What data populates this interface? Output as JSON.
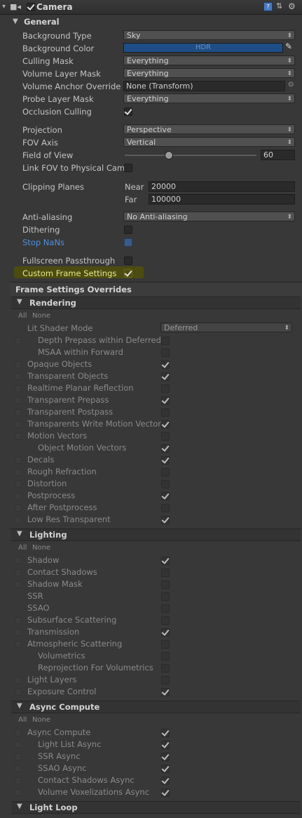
{
  "component": {
    "title": "Camera"
  },
  "general": {
    "title": "General",
    "background_type": {
      "label": "Background Type",
      "value": "Sky"
    },
    "background_color": {
      "label": "Background Color",
      "value": "HDR",
      "color": "#1f4e86"
    },
    "culling_mask": {
      "label": "Culling Mask",
      "value": "Everything"
    },
    "volume_layer_mask": {
      "label": "Volume Layer Mask",
      "value": "Everything"
    },
    "volume_anchor_override": {
      "label": "Volume Anchor Override",
      "value": "None (Transform)"
    },
    "probe_layer_mask": {
      "label": "Probe Layer Mask",
      "value": "Everything"
    },
    "occlusion_culling": {
      "label": "Occlusion Culling",
      "checked": true
    },
    "projection": {
      "label": "Projection",
      "value": "Perspective"
    },
    "fov_axis": {
      "label": "FOV Axis",
      "value": "Vertical"
    },
    "field_of_view": {
      "label": "Field of View",
      "value": "60",
      "slider_fraction": 0.33
    },
    "link_fov": {
      "label": "Link FOV to Physical Cam",
      "checked": false
    },
    "clipping_planes": {
      "label": "Clipping Planes",
      "near_label": "Near",
      "near": "20000",
      "far_label": "Far",
      "far": "100000"
    },
    "anti_aliasing": {
      "label": "Anti-aliasing",
      "value": "No Anti-aliasing"
    },
    "dithering": {
      "label": "Dithering",
      "checked": false
    },
    "stop_nans": {
      "label": "Stop NaNs",
      "checked": false
    },
    "fullscreen_passthrough": {
      "label": "Fullscreen Passthrough",
      "checked": false
    },
    "custom_frame_settings": {
      "label": "Custom Frame Settings",
      "checked": true
    }
  },
  "frame_settings": {
    "title": "Frame Settings Overrides",
    "all": "All",
    "none": "None",
    "rendering": {
      "title": "Rendering",
      "lit_shader_mode": {
        "label": "Lit Shader Mode",
        "value": "Deferred"
      },
      "items": [
        {
          "label": "Depth Prepass within Deferred",
          "checked": false,
          "indent": true,
          "override": true
        },
        {
          "label": "MSAA within Forward",
          "checked": false,
          "indent": true,
          "override": false
        },
        {
          "label": "Opaque Objects",
          "checked": true,
          "indent": false,
          "override": true
        },
        {
          "label": "Transparent Objects",
          "checked": true,
          "indent": false,
          "override": true
        },
        {
          "label": "Realtime Planar Reflection",
          "checked": false,
          "indent": false,
          "override": true
        },
        {
          "label": "Transparent Prepass",
          "checked": true,
          "indent": false,
          "override": true
        },
        {
          "label": "Transparent Postpass",
          "checked": false,
          "indent": false,
          "override": true
        },
        {
          "label": "Transparents Write Motion Vector",
          "checked": true,
          "indent": false,
          "override": true
        },
        {
          "label": "Motion Vectors",
          "checked": false,
          "indent": false,
          "override": true
        },
        {
          "label": "Object Motion Vectors",
          "checked": true,
          "indent": true,
          "override": false
        },
        {
          "label": "Decals",
          "checked": true,
          "indent": false,
          "override": true
        },
        {
          "label": "Rough Refraction",
          "checked": false,
          "indent": false,
          "override": true
        },
        {
          "label": "Distortion",
          "checked": false,
          "indent": false,
          "override": true
        },
        {
          "label": "Postprocess",
          "checked": true,
          "indent": false,
          "override": true
        },
        {
          "label": "After Postprocess",
          "checked": false,
          "indent": false,
          "override": true
        },
        {
          "label": "Low Res Transparent",
          "checked": true,
          "indent": false,
          "override": true
        }
      ]
    },
    "lighting": {
      "title": "Lighting",
      "items": [
        {
          "label": "Shadow",
          "checked": true,
          "indent": false,
          "override": true
        },
        {
          "label": "Contact Shadows",
          "checked": false,
          "indent": false,
          "override": true
        },
        {
          "label": "Shadow Mask",
          "checked": false,
          "indent": false,
          "override": true
        },
        {
          "label": "SSR",
          "checked": false,
          "indent": false,
          "override": false
        },
        {
          "label": "SSAO",
          "checked": false,
          "indent": false,
          "override": false
        },
        {
          "label": "Subsurface Scattering",
          "checked": false,
          "indent": false,
          "override": true
        },
        {
          "label": "Transmission",
          "checked": true,
          "indent": false,
          "override": true
        },
        {
          "label": "Atmospheric Scattering",
          "checked": false,
          "indent": false,
          "override": true
        },
        {
          "label": "Volumetrics",
          "checked": false,
          "indent": true,
          "override": false
        },
        {
          "label": "Reprojection For Volumetrics",
          "checked": false,
          "indent": true,
          "override": false
        },
        {
          "label": "Light Layers",
          "checked": false,
          "indent": false,
          "override": true
        },
        {
          "label": "Exposure Control",
          "checked": true,
          "indent": false,
          "override": true
        }
      ]
    },
    "async": {
      "title": "Async Compute",
      "items": [
        {
          "label": "Async Compute",
          "checked": true,
          "indent": false,
          "override": true
        },
        {
          "label": "Light List Async",
          "checked": true,
          "indent": true,
          "override": true
        },
        {
          "label": "SSR Async",
          "checked": true,
          "indent": true,
          "override": true
        },
        {
          "label": "SSAO Async",
          "checked": true,
          "indent": true,
          "override": true
        },
        {
          "label": "Contact Shadows Async",
          "checked": true,
          "indent": true,
          "override": true
        },
        {
          "label": "Volume Voxelizations Async",
          "checked": true,
          "indent": true,
          "override": true
        }
      ]
    },
    "light_loop": {
      "title": "Light Loop"
    }
  },
  "colors": {
    "highlight": "#4c4c12",
    "link_blue": "#4f8fe0"
  }
}
